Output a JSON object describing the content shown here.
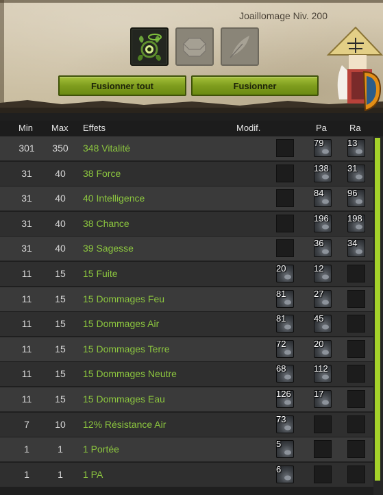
{
  "header": {
    "job_title": "Joaillomage Niv. 200",
    "fuse_all_label": "Fusionner tout",
    "fuse_label": "Fusionner"
  },
  "columns": {
    "min": "Min",
    "max": "Max",
    "effects": "Effets",
    "modif": "Modif.",
    "pa": "Pa",
    "ra": "Ra"
  },
  "colors": {
    "effect_text": "#8cc63f",
    "button_green": "#7f9d1e",
    "scrollbar": "#a5d22a"
  },
  "rows": [
    {
      "min": "301",
      "max": "350",
      "effect": "348 Vitalité",
      "modif": "",
      "pa": "79",
      "ra": "13",
      "modif_icon": "empty-slot",
      "pa_icon": "pa-rune-icon",
      "ra_icon": "ra-rune-icon"
    },
    {
      "min": "31",
      "max": "40",
      "effect": "38 Force",
      "modif": "",
      "pa": "138",
      "ra": "31",
      "modif_icon": "empty-slot",
      "pa_icon": "pa-rune-icon",
      "ra_icon": "ra-rune-icon"
    },
    {
      "min": "31",
      "max": "40",
      "effect": "40 Intelligence",
      "modif": "",
      "pa": "84",
      "ra": "96",
      "modif_icon": "empty-slot",
      "pa_icon": "pa-rune-icon",
      "ra_icon": "ra-rune-icon"
    },
    {
      "min": "31",
      "max": "40",
      "effect": "38 Chance",
      "modif": "",
      "pa": "196",
      "ra": "198",
      "modif_icon": "empty-slot",
      "pa_icon": "pa-rune-icon",
      "ra_icon": "ra-rune-icon"
    },
    {
      "min": "31",
      "max": "40",
      "effect": "39 Sagesse",
      "modif": "",
      "pa": "36",
      "ra": "34",
      "modif_icon": "empty-slot",
      "pa_icon": "pa-rune-icon",
      "ra_icon": "ra-rune-icon"
    },
    {
      "min": "11",
      "max": "15",
      "effect": "15 Fuite",
      "modif": "20",
      "pa": "12",
      "ra": "",
      "modif_icon": "rune-icon",
      "pa_icon": "pa-rune-icon",
      "ra_icon": "empty-slot"
    },
    {
      "min": "11",
      "max": "15",
      "effect": "15 Dommages Feu",
      "modif": "81",
      "pa": "27",
      "ra": "",
      "modif_icon": "rune-icon",
      "pa_icon": "pa-rune-icon",
      "ra_icon": "empty-slot"
    },
    {
      "min": "11",
      "max": "15",
      "effect": "15 Dommages Air",
      "modif": "81",
      "pa": "45",
      "ra": "",
      "modif_icon": "rune-icon",
      "pa_icon": "pa-rune-icon",
      "ra_icon": "empty-slot"
    },
    {
      "min": "11",
      "max": "15",
      "effect": "15 Dommages Terre",
      "modif": "72",
      "pa": "20",
      "ra": "",
      "modif_icon": "rune-icon",
      "pa_icon": "pa-rune-icon",
      "ra_icon": "empty-slot"
    },
    {
      "min": "11",
      "max": "15",
      "effect": "15 Dommages Neutre",
      "modif": "68",
      "pa": "112",
      "ra": "",
      "modif_icon": "rune-icon",
      "pa_icon": "pa-rune-icon",
      "ra_icon": "empty-slot"
    },
    {
      "min": "11",
      "max": "15",
      "effect": "15 Dommages Eau",
      "modif": "126",
      "pa": "17",
      "ra": "",
      "modif_icon": "rune-icon",
      "pa_icon": "pa-rune-icon",
      "ra_icon": "empty-slot"
    },
    {
      "min": "7",
      "max": "10",
      "effect": "12% Résistance Air",
      "modif": "73",
      "pa": "",
      "ra": "",
      "modif_icon": "rune-icon",
      "pa_icon": "empty-slot",
      "ra_icon": "empty-slot"
    },
    {
      "min": "1",
      "max": "1",
      "effect": "1 Portée",
      "modif": "5",
      "pa": "",
      "ra": "",
      "modif_icon": "rune-icon",
      "pa_icon": "empty-slot",
      "ra_icon": "empty-slot"
    },
    {
      "min": "1",
      "max": "1",
      "effect": "1 PA",
      "modif": "6",
      "pa": "",
      "ra": "",
      "modif_icon": "rune-icon",
      "pa_icon": "empty-slot",
      "ra_icon": "empty-slot"
    }
  ]
}
